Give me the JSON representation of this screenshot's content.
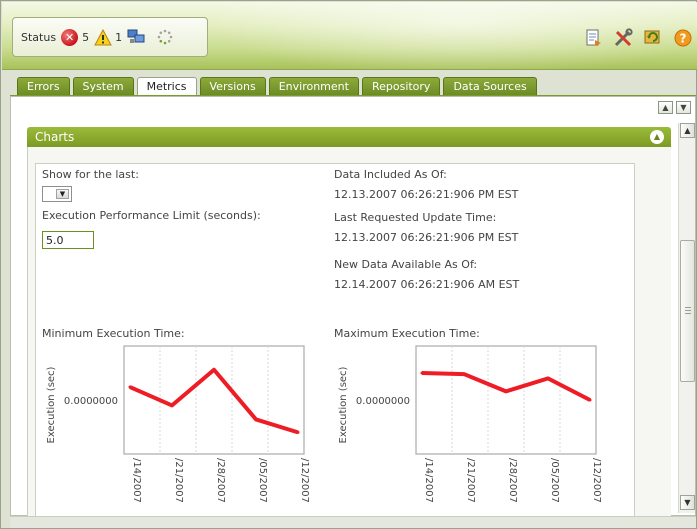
{
  "status": {
    "label": "Status",
    "error_count": "5",
    "warning_count": "1",
    "icons": [
      "error-icon",
      "warning-icon",
      "network-icon",
      "spinner-icon"
    ]
  },
  "toolbar": {
    "icons": [
      "report-icon",
      "tools-icon",
      "refresh-icon",
      "help-icon"
    ]
  },
  "tabs": [
    {
      "label": "Errors"
    },
    {
      "label": "System"
    },
    {
      "label": "Metrics",
      "active": true
    },
    {
      "label": "Versions"
    },
    {
      "label": "Environment"
    },
    {
      "label": "Repository"
    },
    {
      "label": "Data Sources"
    }
  ],
  "charts_panel": {
    "title": "Charts",
    "show_for_last_label": "Show for the last:",
    "show_for_last_value": "",
    "limit_label": "Execution Performance Limit (seconds):",
    "limit_value": "5.0",
    "data_included_label": "Data Included As Of:",
    "data_included_value": "12.13.2007 06:26:21:906 PM EST",
    "last_requested_label": "Last Requested Update Time:",
    "last_requested_value": "12.13.2007 06:26:21:906 PM EST",
    "new_data_label": "New Data Available As Of:",
    "new_data_value": "12.14.2007 06:26:21:906 AM EST"
  },
  "chart_data": [
    {
      "type": "line",
      "title": "Minimum Execution Time:",
      "ylabel": "Execution (sec)",
      "y_tick_label": "0.0000000",
      "categories": [
        "/14/2007",
        "/21/2007",
        "/28/2007",
        "/05/2007",
        "/12/2007"
      ],
      "values": [
        0.62,
        0.45,
        0.78,
        0.32,
        0.2
      ],
      "ylim": [
        0,
        1
      ],
      "color": "#ee1c24"
    },
    {
      "type": "line",
      "title": "Maximum Execution Time:",
      "ylabel": "Execution (sec)",
      "y_tick_label": "0.0000000",
      "categories": [
        "/14/2007",
        "/21/2007",
        "/28/2007",
        "/05/2007",
        "/12/2007"
      ],
      "values": [
        0.75,
        0.74,
        0.58,
        0.7,
        0.5
      ],
      "ylim": [
        0,
        1
      ],
      "color": "#ee1c24"
    }
  ],
  "colors": {
    "accent_green": "#7c9a22",
    "tab_green": "#6d8b25",
    "series_red": "#ee1c24"
  }
}
